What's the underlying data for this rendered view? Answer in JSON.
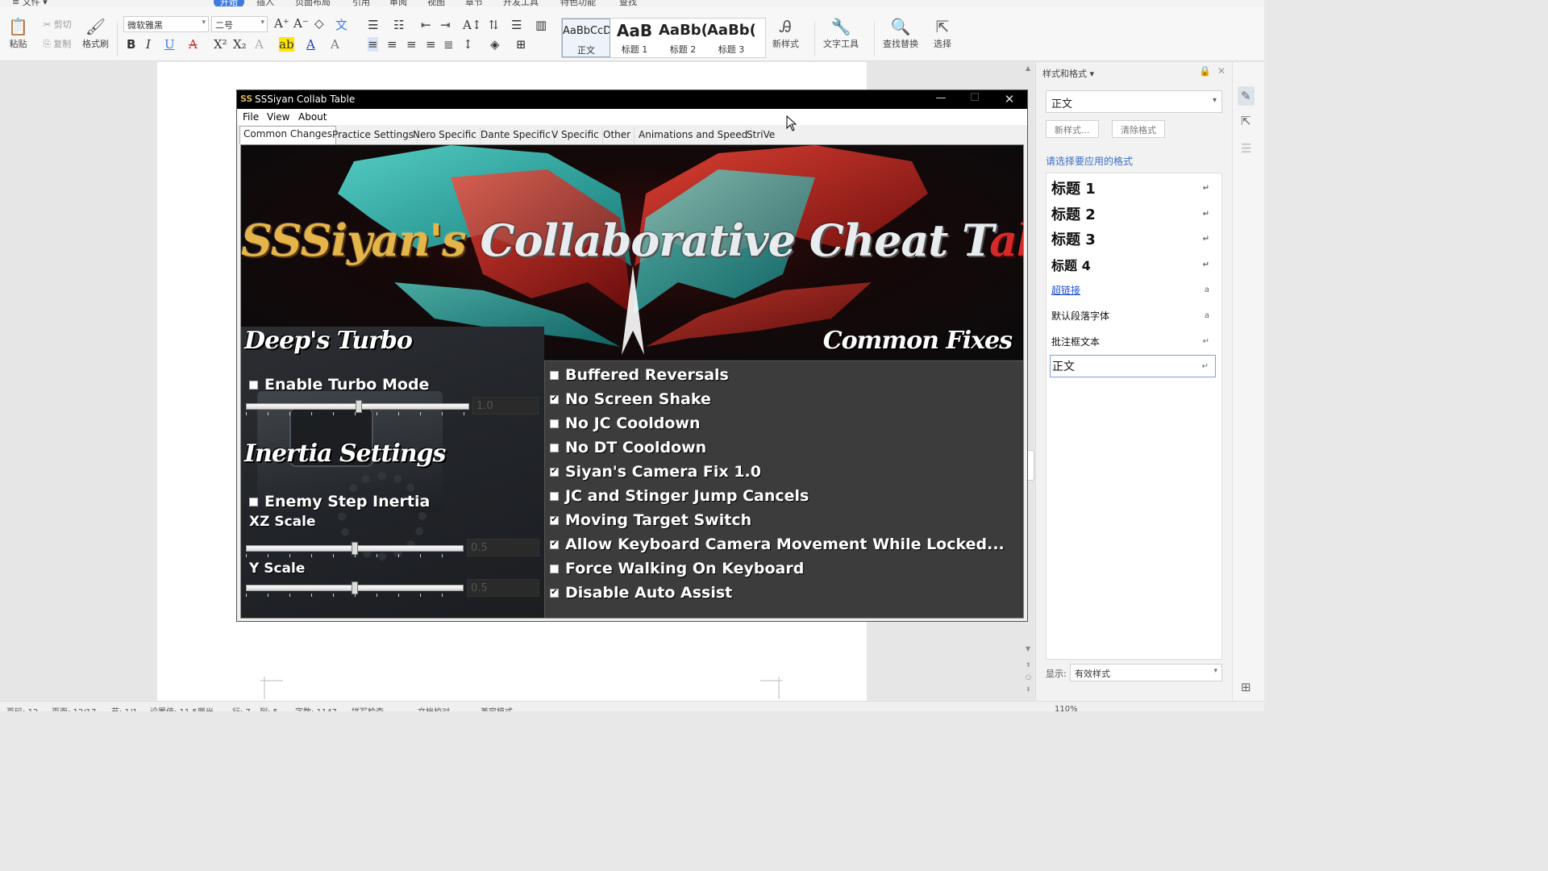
{
  "ribbon": {
    "tabs": [
      "开始",
      "插入",
      "页面布局",
      "引用",
      "审阅",
      "视图",
      "章节",
      "开发工具",
      "特色功能",
      "查找"
    ],
    "active_tab": "开始",
    "paste": "粘贴",
    "cut": "剪切",
    "copy": "复制",
    "format_painter": "格式刷",
    "font_name": "微软雅黑",
    "font_size": "二号",
    "styles": [
      {
        "sample": "AaBbCcDd",
        "label": "正文"
      },
      {
        "sample": "AaB",
        "label": "标题 1"
      },
      {
        "sample": "AaBb(",
        "label": "标题 2"
      },
      {
        "sample": "AaBb(",
        "label": "标题 3"
      }
    ],
    "new_style": "新样式",
    "text_tools": "文字工具",
    "find_replace": "查找替换",
    "select": "选择"
  },
  "app": {
    "title": "SSSiyan Collab Table",
    "logo": "SS",
    "menu": [
      "File",
      "View",
      "About"
    ],
    "tabs": [
      "Common Changes",
      "Practice Settings",
      "Nero Specific",
      "Dante Specific",
      "V Specific",
      "Other",
      "Animations and Speed",
      "StriVe"
    ],
    "active_tab": "Common Changes",
    "banner": {
      "part1": "SSSiyan's",
      "part2": " Collaborative Cheat T",
      "part3": "able"
    },
    "left": {
      "heading1": "Deep's Turbo",
      "turbo_label": "Enable Turbo Mode",
      "turbo_value": "1.0",
      "turbo_checked": false,
      "heading2": "Inertia Settings",
      "inertia_label": "Enemy Step Inertia",
      "inertia_checked": false,
      "xz_label": "XZ Scale",
      "xz_value": "0.5",
      "y_label": "Y Scale",
      "y_value": "0.5"
    },
    "right": {
      "heading": "Common Fixes",
      "options": [
        {
          "label": "Buffered Reversals",
          "checked": false
        },
        {
          "label": "No Screen Shake",
          "checked": true
        },
        {
          "label": "No JC Cooldown",
          "checked": false
        },
        {
          "label": "No DT Cooldown",
          "checked": false
        },
        {
          "label": "Siyan's Camera Fix 1.0",
          "checked": true
        },
        {
          "label": "JC and Stinger Jump Cancels",
          "checked": false
        },
        {
          "label": "Moving Target Switch",
          "checked": true
        },
        {
          "label": "Allow Keyboard Camera Movement While Locked...",
          "checked": true
        },
        {
          "label": "Force Walking On Keyboard",
          "checked": false
        },
        {
          "label": "Disable Auto Assist",
          "checked": true
        }
      ]
    }
  },
  "side_panel": {
    "title": "样式和格式",
    "current": "正文",
    "new_style_btn": "新样式...",
    "clear_btn": "清除格式",
    "hint": "请选择要应用的格式",
    "items": [
      {
        "name": "标题 1",
        "mark": "↵"
      },
      {
        "name": "标题 2",
        "mark": "↵"
      },
      {
        "name": "标题 3",
        "mark": "↵"
      },
      {
        "name": "标题 4",
        "mark": "↵"
      },
      {
        "name": "超链接",
        "mark": "a"
      },
      {
        "name": "默认段落字体",
        "mark": "a"
      },
      {
        "name": "批注框文本",
        "mark": "↵"
      },
      {
        "name": "正文",
        "mark": "↵"
      }
    ],
    "show_label": "显示:",
    "show_value": "有效样式"
  },
  "statusbar": {
    "page": "页码: 12",
    "pages": "页面: 12/17",
    "section": "节: 1/1",
    "setting": "设置值: 11.5厘米",
    "row": "行: 7",
    "col": "列: 5",
    "words": "字数: 1147",
    "spell": "拼写检查",
    "proof": "文档校对",
    "compat": "兼容模式",
    "zoom": "110%"
  }
}
